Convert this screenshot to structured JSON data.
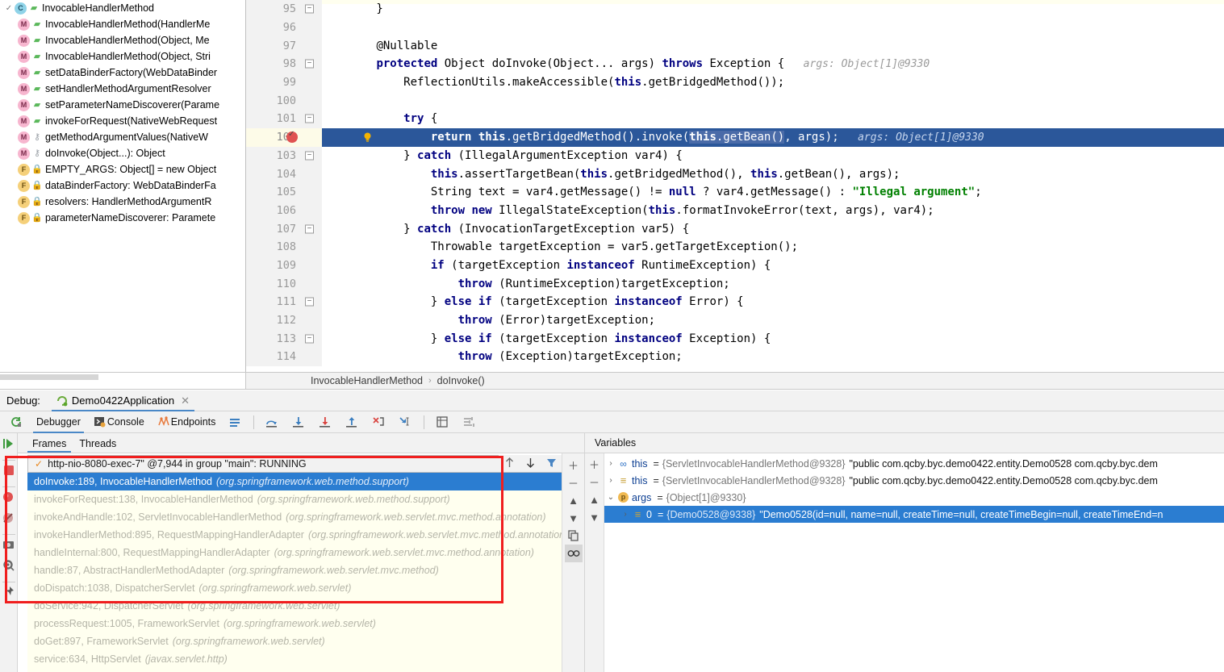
{
  "structure": {
    "root": {
      "label": "InvocableHandlerMethod",
      "kind": "c",
      "vis": "pub"
    },
    "items": [
      {
        "label": "InvocableHandlerMethod(HandlerMe",
        "kind": "m",
        "vis": "pub"
      },
      {
        "label": "InvocableHandlerMethod(Object, Me",
        "kind": "m",
        "vis": "pub"
      },
      {
        "label": "InvocableHandlerMethod(Object, Stri",
        "kind": "m",
        "vis": "pub"
      },
      {
        "label": "setDataBinderFactory(WebDataBinder",
        "kind": "m",
        "vis": "pub"
      },
      {
        "label": "setHandlerMethodArgumentResolver",
        "kind": "m",
        "vis": "pub"
      },
      {
        "label": "setParameterNameDiscoverer(Parame",
        "kind": "m",
        "vis": "pub"
      },
      {
        "label": "invokeForRequest(NativeWebRequest",
        "kind": "m",
        "vis": "pub"
      },
      {
        "label": "getMethodArgumentValues(NativeW",
        "kind": "m",
        "vis": "priv"
      },
      {
        "label": "doInvoke(Object...): Object",
        "kind": "m",
        "vis": "priv"
      },
      {
        "label": "EMPTY_ARGS: Object[] = new Object",
        "kind": "f",
        "vis": "prot"
      },
      {
        "label": "dataBinderFactory: WebDataBinderFa",
        "kind": "f",
        "vis": "prot"
      },
      {
        "label": "resolvers: HandlerMethodArgumentR",
        "kind": "f",
        "vis": "prot"
      },
      {
        "label": "parameterNameDiscoverer: Paramete",
        "kind": "f",
        "vis": "prot"
      }
    ]
  },
  "editor": {
    "lines": [
      {
        "num": "95",
        "fold": "minus",
        "tokens": [
          {
            "t": "        }",
            "c": "plain"
          }
        ]
      },
      {
        "num": "96",
        "fold": "",
        "tokens": []
      },
      {
        "num": "97",
        "fold": "",
        "tokens": [
          {
            "t": "        ",
            "c": "plain"
          },
          {
            "t": "@Nullable",
            "c": "plain"
          }
        ]
      },
      {
        "num": "98",
        "fold": "minus",
        "tokens": [
          {
            "t": "        ",
            "c": "plain"
          },
          {
            "t": "protected",
            "c": "kw"
          },
          {
            "t": " Object doInvoke(Object... args) ",
            "c": "plain"
          },
          {
            "t": "throws",
            "c": "kw"
          },
          {
            "t": " Exception {",
            "c": "plain"
          },
          {
            "t": "   args: Object[1]@9330",
            "c": "hint"
          }
        ]
      },
      {
        "num": "99",
        "fold": "",
        "tokens": [
          {
            "t": "            ReflectionUtils.makeAccessible(",
            "c": "plain"
          },
          {
            "t": "this",
            "c": "kw"
          },
          {
            "t": ".getBridgedMethod());",
            "c": "plain"
          }
        ]
      },
      {
        "num": "100",
        "fold": "",
        "tokens": []
      },
      {
        "num": "101",
        "fold": "minus",
        "tokens": [
          {
            "t": "            ",
            "c": "plain"
          },
          {
            "t": "try",
            "c": "kw"
          },
          {
            "t": " {",
            "c": "plain"
          }
        ]
      },
      {
        "num": "102",
        "fold": "",
        "current": true,
        "breakpoint": true,
        "bulb": true,
        "tokens": [
          {
            "t": "                ",
            "c": "plain-w"
          },
          {
            "t": "return",
            "c": "kw-w"
          },
          {
            "t": " ",
            "c": "plain-w"
          },
          {
            "t": "this",
            "c": "kw-w"
          },
          {
            "t": ".getBridgedMethod().invoke(",
            "c": "plain-w"
          },
          {
            "t": "this",
            "c": "kw-w sel-tok"
          },
          {
            "t": ".getBean()",
            "c": "plain-w sel-tok"
          },
          {
            "t": ", args);",
            "c": "plain-w"
          },
          {
            "t": "   args: Object[1]@9330",
            "c": "hint-w"
          }
        ]
      },
      {
        "num": "103",
        "fold": "minus",
        "tokens": [
          {
            "t": "            } ",
            "c": "plain"
          },
          {
            "t": "catch",
            "c": "kw"
          },
          {
            "t": " (IllegalArgumentException var4) {",
            "c": "plain"
          }
        ]
      },
      {
        "num": "104",
        "fold": "",
        "tokens": [
          {
            "t": "                ",
            "c": "plain"
          },
          {
            "t": "this",
            "c": "kw"
          },
          {
            "t": ".assertTargetBean(",
            "c": "plain"
          },
          {
            "t": "this",
            "c": "kw"
          },
          {
            "t": ".getBridgedMethod(), ",
            "c": "plain"
          },
          {
            "t": "this",
            "c": "kw"
          },
          {
            "t": ".getBean(), args);",
            "c": "plain"
          }
        ]
      },
      {
        "num": "105",
        "fold": "",
        "tokens": [
          {
            "t": "                String text = var4.getMessage() != ",
            "c": "plain"
          },
          {
            "t": "null",
            "c": "kw"
          },
          {
            "t": " ? var4.getMessage() : ",
            "c": "plain"
          },
          {
            "t": "\"Illegal argument\"",
            "c": "str"
          },
          {
            "t": ";",
            "c": "plain"
          }
        ]
      },
      {
        "num": "106",
        "fold": "",
        "tokens": [
          {
            "t": "                ",
            "c": "plain"
          },
          {
            "t": "throw",
            "c": "kw"
          },
          {
            "t": " ",
            "c": "plain"
          },
          {
            "t": "new",
            "c": "kw"
          },
          {
            "t": " IllegalStateException(",
            "c": "plain"
          },
          {
            "t": "this",
            "c": "kw"
          },
          {
            "t": ".formatInvokeError(text, args), var4);",
            "c": "plain"
          }
        ]
      },
      {
        "num": "107",
        "fold": "minus",
        "tokens": [
          {
            "t": "            } ",
            "c": "plain"
          },
          {
            "t": "catch",
            "c": "kw"
          },
          {
            "t": " (InvocationTargetException var5) {",
            "c": "plain"
          }
        ]
      },
      {
        "num": "108",
        "fold": "",
        "tokens": [
          {
            "t": "                Throwable targetException = var5.getTargetException();",
            "c": "plain"
          }
        ]
      },
      {
        "num": "109",
        "fold": "",
        "tokens": [
          {
            "t": "                ",
            "c": "plain"
          },
          {
            "t": "if",
            "c": "kw"
          },
          {
            "t": " (targetException ",
            "c": "plain"
          },
          {
            "t": "instanceof",
            "c": "kw"
          },
          {
            "t": " RuntimeException) {",
            "c": "plain"
          }
        ]
      },
      {
        "num": "110",
        "fold": "",
        "tokens": [
          {
            "t": "                    ",
            "c": "plain"
          },
          {
            "t": "throw",
            "c": "kw"
          },
          {
            "t": " (RuntimeException)targetException;",
            "c": "plain"
          }
        ]
      },
      {
        "num": "111",
        "fold": "minus",
        "tokens": [
          {
            "t": "                } ",
            "c": "plain"
          },
          {
            "t": "else if",
            "c": "kw"
          },
          {
            "t": " (targetException ",
            "c": "plain"
          },
          {
            "t": "instanceof",
            "c": "kw"
          },
          {
            "t": " Error) {",
            "c": "plain"
          }
        ]
      },
      {
        "num": "112",
        "fold": "",
        "tokens": [
          {
            "t": "                    ",
            "c": "plain"
          },
          {
            "t": "throw",
            "c": "kw"
          },
          {
            "t": " (Error)targetException;",
            "c": "plain"
          }
        ]
      },
      {
        "num": "113",
        "fold": "minus",
        "tokens": [
          {
            "t": "                } ",
            "c": "plain"
          },
          {
            "t": "else if",
            "c": "kw"
          },
          {
            "t": " (targetException ",
            "c": "plain"
          },
          {
            "t": "instanceof",
            "c": "kw"
          },
          {
            "t": " Exception) {",
            "c": "plain"
          }
        ]
      },
      {
        "num": "114",
        "fold": "",
        "tokens": [
          {
            "t": "                    ",
            "c": "plain"
          },
          {
            "t": "throw",
            "c": "kw"
          },
          {
            "t": " (Exception)targetException;",
            "c": "plain"
          }
        ]
      }
    ]
  },
  "breadcrumb": {
    "class": "InvocableHandlerMethod",
    "separator": "›",
    "method": "doInvoke()"
  },
  "debug": {
    "label": "Debug:",
    "session_tab": "Demo0422Application",
    "close": "✕",
    "toolbar": {
      "rerun_icon": "rerun-icon",
      "tabs": [
        {
          "label": "Debugger",
          "icon": "",
          "active": true
        },
        {
          "label": "Console",
          "icon": "console-icon",
          "active": false
        },
        {
          "label": "Endpoints",
          "icon": "endpoints-icon",
          "active": false
        }
      ],
      "layout_icon": "layout-icon",
      "step_icons": [
        "step-over-icon",
        "step-into-icon",
        "force-step-into-icon",
        "step-out-icon",
        "drop-frame-icon",
        "run-to-cursor-icon"
      ],
      "extra_icons": [
        "evaluate-icon",
        "settings-icon"
      ]
    },
    "frames": {
      "tabs": [
        {
          "label": "Frames",
          "active": true
        },
        {
          "label": "Threads",
          "active": false
        }
      ],
      "thread": "http-nio-8080-exec-7\" @7,944 in group \"main\": RUNNING",
      "thread_check": "✓",
      "toolbar_icons": [
        "arrow-up-icon",
        "arrow-down-icon",
        "filter-icon"
      ],
      "side_icons": [
        "plus-icon",
        "minus-icon",
        "sort-up-icon",
        "sort-down-icon",
        "copy-icon",
        "watches-icon"
      ],
      "items": [
        {
          "name": "doInvoke:189, InvocableHandlerMethod",
          "pkg": "(org.springframework.web.method.support)",
          "selected": true
        },
        {
          "name": "invokeForRequest:138, InvocableHandlerMethod",
          "pkg": "(org.springframework.web.method.support)",
          "selected": false
        },
        {
          "name": "invokeAndHandle:102, ServletInvocableHandlerMethod",
          "pkg": "(org.springframework.web.servlet.mvc.method.annotation)",
          "selected": false
        },
        {
          "name": "invokeHandlerMethod:895, RequestMappingHandlerAdapter",
          "pkg": "(org.springframework.web.servlet.mvc.method.annotation)",
          "selected": false
        },
        {
          "name": "handleInternal:800, RequestMappingHandlerAdapter",
          "pkg": "(org.springframework.web.servlet.mvc.method.annotation)",
          "selected": false
        },
        {
          "name": "handle:87, AbstractHandlerMethodAdapter",
          "pkg": "(org.springframework.web.servlet.mvc.method)",
          "selected": false
        },
        {
          "name": "doDispatch:1038, DispatcherServlet",
          "pkg": "(org.springframework.web.servlet)",
          "selected": false
        },
        {
          "name": "doService:942, DispatcherServlet",
          "pkg": "(org.springframework.web.servlet)",
          "selected": false
        },
        {
          "name": "processRequest:1005, FrameworkServlet",
          "pkg": "(org.springframework.web.servlet)",
          "selected": false
        },
        {
          "name": "doGet:897, FrameworkServlet",
          "pkg": "(org.springframework.web.servlet)",
          "selected": false
        },
        {
          "name": "service:634, HttpServlet",
          "pkg": "(javax.servlet.http)",
          "selected": false
        }
      ]
    },
    "variables": {
      "header": "Variables",
      "side_icons": [
        "plus-icon",
        "minus-icon",
        "sort-up-icon",
        "sort-down-icon"
      ],
      "rows": [
        {
          "arrow": "›",
          "icon": "∞",
          "icon_name": "static-field-icon",
          "name": "this",
          "eq": "=",
          "type": "{ServletInvocableHandlerMethod@9328}",
          "value": "\"public com.qcby.byc.demo0422.entity.Demo0528 com.qcby.byc.dem",
          "indent": 0,
          "selected": false
        },
        {
          "arrow": "›",
          "icon": "≡",
          "icon_name": "field-icon",
          "name": "this",
          "eq": "=",
          "type": "{ServletInvocableHandlerMethod@9328}",
          "value": "\"public com.qcby.byc.demo0422.entity.Demo0528 com.qcby.byc.dem",
          "indent": 0,
          "selected": false
        },
        {
          "arrow": "⌄",
          "icon": "p",
          "icon_name": "parameter-icon",
          "name": "args",
          "eq": "=",
          "type": "{Object[1]@9330}",
          "value": "",
          "indent": 0,
          "selected": false
        },
        {
          "arrow": "›",
          "icon": "≡",
          "icon_name": "field-icon",
          "name": "0",
          "eq": "=",
          "type": "{Demo0528@9338}",
          "value": "\"Demo0528(id=null, name=null, createTime=null, createTimeBegin=null, createTimeEnd=n",
          "indent": 1,
          "selected": true
        }
      ]
    },
    "left_strip_icons": [
      "resume-icon",
      "stop-icon",
      "breakpoints-icon",
      "mute-breakpoints-icon",
      "camera-icon",
      "settings-icon",
      "pin-icon"
    ]
  },
  "colors": {
    "selection_blue": "#2b579a",
    "frame_selected": "#2b7dd1",
    "frame_bg": "#ffffef",
    "annotation_red": "#f01e1e",
    "accent": "#4a88c7"
  }
}
